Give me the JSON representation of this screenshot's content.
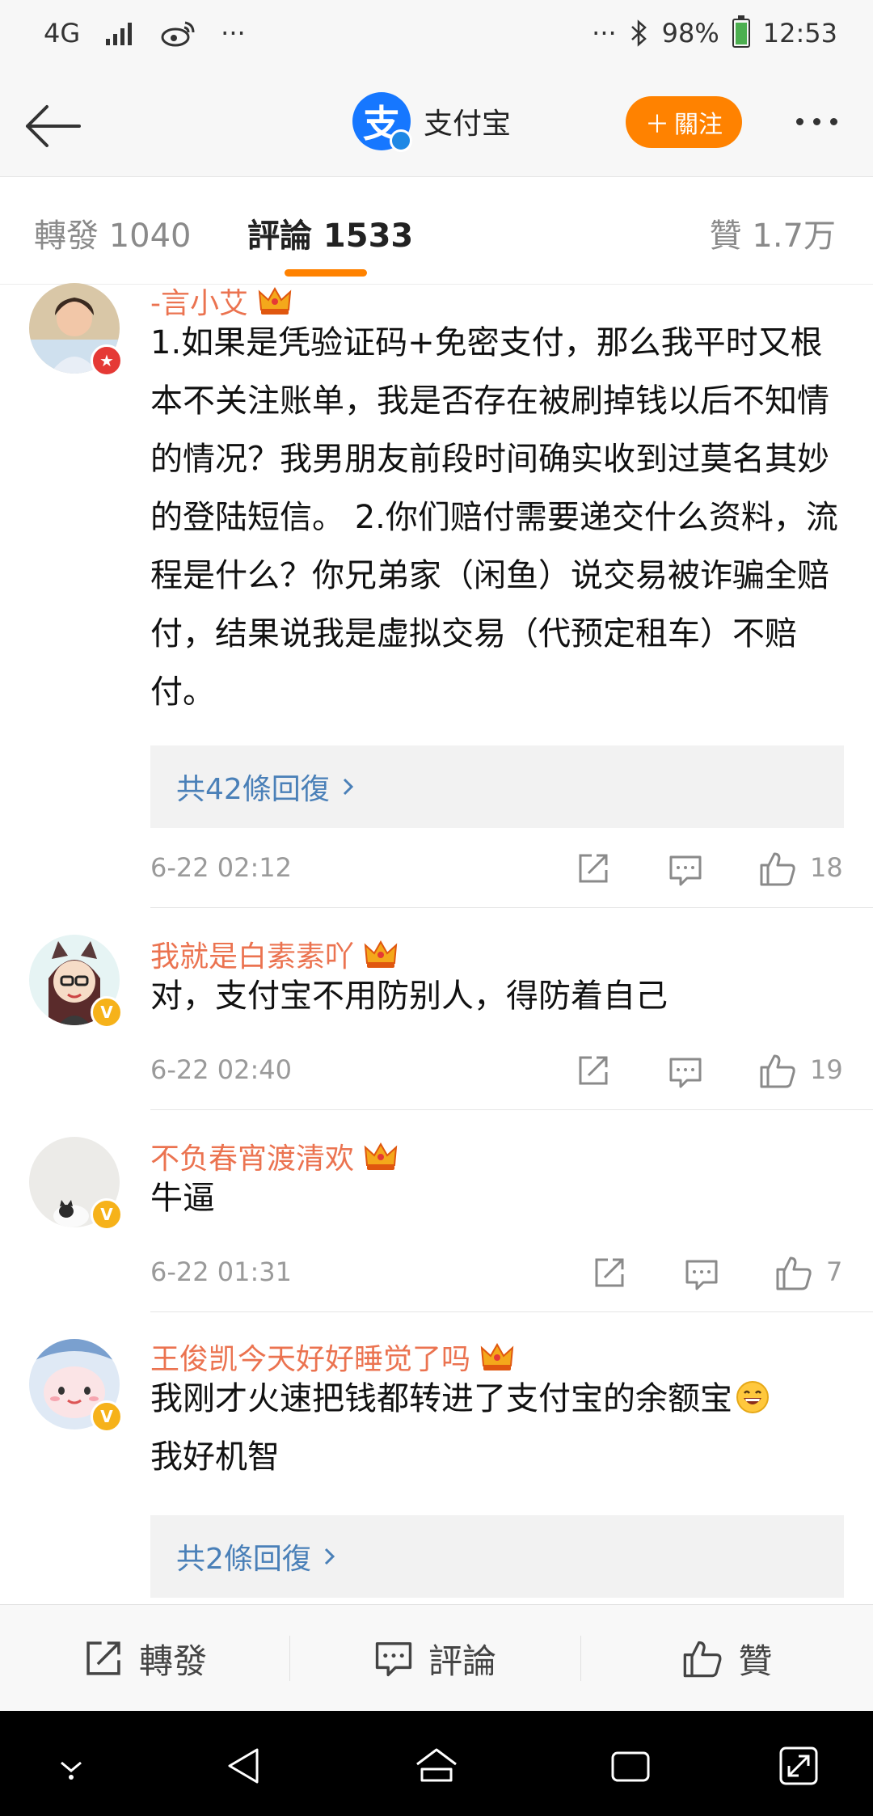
{
  "status_bar": {
    "network": "4G",
    "more_left": "···",
    "more_right": "···",
    "battery_percent": "98%",
    "time": "12:53"
  },
  "header": {
    "account_name": "支付宝",
    "logo_glyph": "支",
    "follow_label": "關注",
    "follow_plus": "＋"
  },
  "tabs": {
    "repost": "轉發 1040",
    "comments": "評論 1533",
    "likes": "贊 1.7万"
  },
  "comments": [
    {
      "username": "-言小艾",
      "text": "1.如果是凭验证码+免密支付，那么我平时又根本不关注账单，我是否存在被刷掉钱以后不知情的情况？我男朋友前段时间确实收到过莫名其妙的登陆短信。 2.你们赔付需要递交什么资料，流程是什么？你兄弟家（闲鱼）说交易被诈骗全赔付，结果说我是虚拟交易（代预定租车）不赔付。",
      "replies": "共42條回復",
      "time": "6-22 02:12",
      "likes": "18"
    },
    {
      "username": "我就是白素素吖",
      "text": "对，支付宝不用防别人，得防着自己",
      "time": "6-22 02:40",
      "likes": "19"
    },
    {
      "username": "不负春宵渡清欢",
      "text": "牛逼",
      "time": "6-22 01:31",
      "likes": "7"
    },
    {
      "username": "王俊凯今天好好睡觉了吗",
      "text": "我刚才火速把钱都转进了支付宝的余额宝",
      "text_line2": "我好机智",
      "replies": "共2條回復"
    }
  ],
  "bottom_bar": {
    "repost": "轉發",
    "comment": "評論",
    "like": "贊"
  },
  "colors": {
    "accent_orange": "#ff8200",
    "username_orange": "#eb7350",
    "reply_link_blue": "#4a80b8",
    "brand_blue": "#1677ff"
  }
}
